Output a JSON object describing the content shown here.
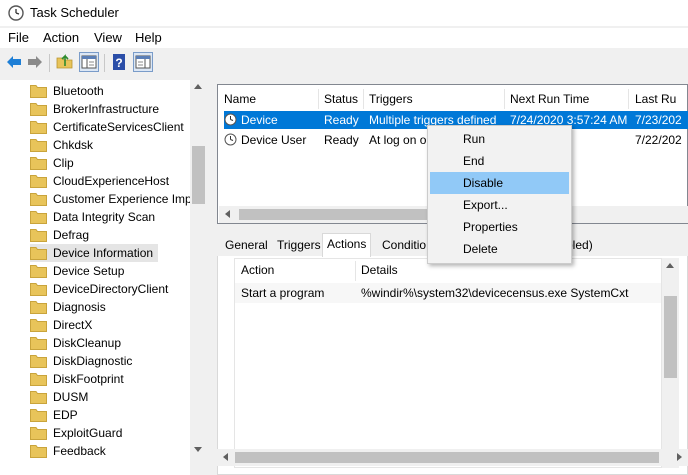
{
  "window": {
    "title": "Task Scheduler"
  },
  "menu": [
    "File",
    "Action",
    "View",
    "Help"
  ],
  "tree": {
    "items": [
      "Bluetooth",
      "BrokerInfrastructure",
      "CertificateServicesClient",
      "Chkdsk",
      "Clip",
      "CloudExperienceHost",
      "Customer Experience Imp",
      "Data Integrity Scan",
      "Defrag",
      "Device Information",
      "Device Setup",
      "DeviceDirectoryClient",
      "Diagnosis",
      "DirectX",
      "DiskCleanup",
      "DiskDiagnostic",
      "DiskFootprint",
      "DUSM",
      "EDP",
      "ExploitGuard",
      "Feedback"
    ],
    "selected": "Device Information"
  },
  "tasks": {
    "columns": [
      "Name",
      "Status",
      "Triggers",
      "Next Run Time",
      "Last Ru"
    ],
    "rows": [
      {
        "name": "Device",
        "status": "Ready",
        "triggers": "Multiple triggers defined",
        "next_run": "7/24/2020 3:57:24 AM",
        "last_run": "7/23/202"
      },
      {
        "name": "Device User",
        "status": "Ready",
        "triggers": "At log on o",
        "next_run": "",
        "last_run": "7/22/202"
      }
    ]
  },
  "detail_tabs": [
    "General",
    "Triggers",
    "Actions",
    "Conditio",
    "bled)"
  ],
  "actions": {
    "columns": [
      "Action",
      "Details"
    ],
    "rows": [
      {
        "action": "Start a program",
        "details": "%windir%\\system32\\devicecensus.exe SystemCxt"
      }
    ]
  },
  "context_menu": {
    "items": [
      "Run",
      "End",
      "Disable",
      "Export...",
      "Properties",
      "Delete"
    ],
    "highlighted": "Disable"
  },
  "colors": {
    "selection": "#0078d7",
    "menu_highlight": "#91c9f7",
    "folder": "#e8c45a"
  }
}
